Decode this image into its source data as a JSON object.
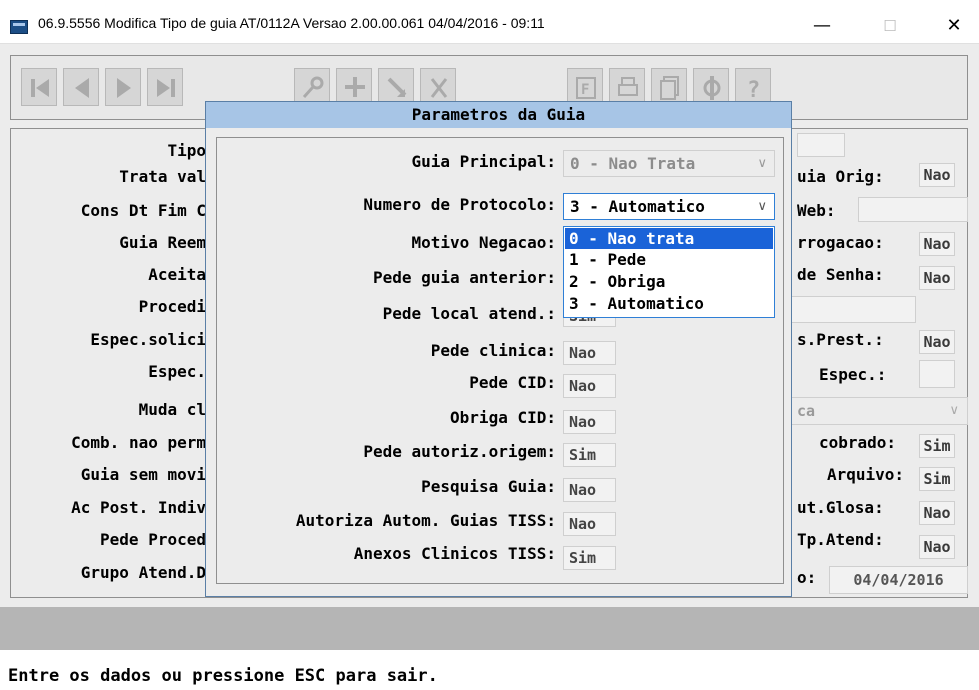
{
  "top_strip": {
    "left_text": "...",
    "right_text": "..."
  },
  "window": {
    "title": "06.9.5556  Modifica  Tipo de guia AT/0112A Versao 2.00.00.061 04/04/2016 - 09:11",
    "min_glyph": "—",
    "max_glyph": "☐",
    "close_glyph": "✕"
  },
  "toolbar": {
    "buttons": [
      "first-record-icon",
      "previous-record-icon",
      "next-record-icon",
      "last-record-icon",
      "search-key-icon",
      "add-record-icon",
      "edit-record-icon",
      "delete-record-icon",
      "filter-icon",
      "print-icon",
      "copy-icon",
      "config-icon",
      "help-icon"
    ]
  },
  "background_form": {
    "left_labels": [
      "Tipo",
      "Trata val",
      "Cons Dt Fim C",
      "Guia Reem",
      "Aceita",
      "Procedi",
      "Espec.solici",
      "Espec.",
      "Muda cl",
      "Comb. nao perm",
      "Guia sem movi",
      "Ac Post. Indiv",
      "Pede Proced",
      "Grupo Atend.D"
    ],
    "right_fields": [
      {
        "label": "uia Orig:",
        "value": "Nao"
      },
      {
        "label": "Web:",
        "value": ""
      },
      {
        "label": "rrogacao:",
        "value": "Nao"
      },
      {
        "label": "de Senha:",
        "value": "Nao"
      },
      {
        "label": "s.Prest.:",
        "value": "Nao"
      },
      {
        "label": "Espec.:",
        "value": ""
      },
      {
        "label": "cobrado:",
        "value": "Sim"
      },
      {
        "label": "Arquivo:",
        "value": "Sim"
      },
      {
        "label": "ut.Glosa:",
        "value": "Nao"
      },
      {
        "label": "Tp.Atend:",
        "value": "Nao"
      },
      {
        "label": "o:",
        "value": "04/04/2016"
      }
    ],
    "partial_combo": "ca"
  },
  "dialog": {
    "title": "Parametros da Guia",
    "guia_principal": {
      "label": "Guia Principal:",
      "value": "0 - Nao Trata"
    },
    "numero_protocolo": {
      "label": "Numero de Protocolo:",
      "value": "3 - Automatico",
      "options": [
        "0 - Nao trata",
        "1 - Pede",
        "2 - Obriga",
        "3 - Automatico"
      ],
      "highlighted_option": "0 - Nao trata"
    },
    "fields": [
      {
        "label": "Motivo Negacao:",
        "value": ""
      },
      {
        "label": "Pede guia anterior:",
        "value": ""
      },
      {
        "label": "Pede local atend.:",
        "value": "Sim"
      },
      {
        "label": "Pede clinica:",
        "value": "Nao"
      },
      {
        "label": "Pede CID:",
        "value": "Nao"
      },
      {
        "label": "Obriga CID:",
        "value": "Nao"
      },
      {
        "label": "Pede autoriz.origem:",
        "value": "Sim"
      },
      {
        "label": "Pesquisa Guia:",
        "value": "Nao"
      },
      {
        "label": "Autoriza Autom. Guias TISS:",
        "value": "Nao"
      },
      {
        "label": "Anexos Clinicos TISS:",
        "value": "Sim"
      }
    ]
  },
  "status": {
    "message": "Entre os dados ou pressione ESC para sair."
  },
  "colors": {
    "dialog_title_bg": "#a7c5e6",
    "selection": "#1a63d8",
    "focus_border": "#2f7fd6",
    "window_bg": "#ececec",
    "gray_band": "#b5b5b5"
  }
}
